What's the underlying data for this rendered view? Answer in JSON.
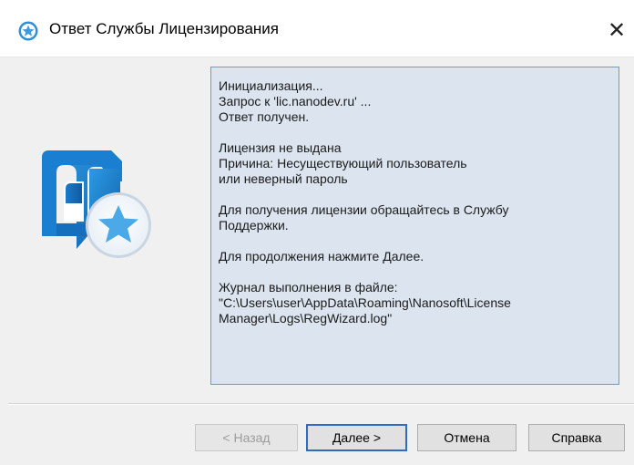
{
  "window": {
    "title": "Ответ Службы Лицензирования",
    "close_glyph": "✕"
  },
  "icons": {
    "title_icon": "star-badge-icon",
    "logo": "app-logo-with-star-icon",
    "close": "close-icon"
  },
  "colors": {
    "panel_background": "#dce5ef",
    "panel_border": "#6c9cc6",
    "default_button_border": "#2d6cc0",
    "logo_blue": "#1e88d0",
    "star_blue": "#4aa9e6"
  },
  "message": {
    "lines": [
      "Инициализация...",
      "Запрос к 'lic.nanodev.ru' ...",
      "Ответ получен.",
      "",
      "Лицензия не выдана",
      "Причина: Несуществующий пользователь",
      "или неверный пароль",
      "",
      "Для получения лицензии обращайтесь в Службу",
      "Поддержки.",
      "",
      "Для продолжения нажмите Далее.",
      "",
      "Журнал выполнения в файле:",
      "\"C:\\Users\\user\\AppData\\Roaming\\Nanosoft\\License",
      "Manager\\Logs\\RegWizard.log\""
    ]
  },
  "buttons": {
    "back": "< Назад",
    "next": "Далее >",
    "cancel": "Отмена",
    "help": "Справка"
  }
}
